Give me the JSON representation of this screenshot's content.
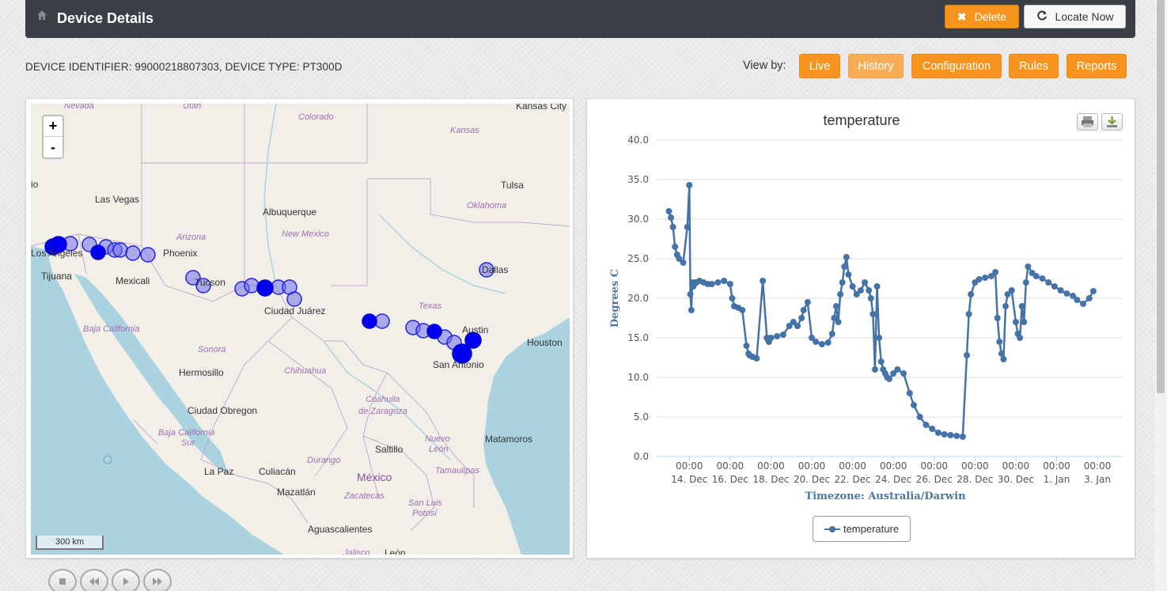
{
  "header": {
    "title": "Device Details",
    "delete_label": "Delete",
    "locate_label": "Locate Now"
  },
  "device_info": "DEVICE IDENTIFIER: 99000218807303, DEVICE TYPE: PT300D",
  "view_by": {
    "label": "View by:",
    "buttons": [
      "Live",
      "History",
      "Configuration",
      "Rules",
      "Reports"
    ],
    "active": "History"
  },
  "map": {
    "zoom_in": "+",
    "zoom_out": "-",
    "scale": "300 km",
    "labels": {
      "nevada": "Nevada",
      "utah": "Utah",
      "colorado": "Colorado",
      "kansas_city": "Kansas City",
      "kansas": "Kansas",
      "tulsa": "Tulsa",
      "oklahoma": "Oklahoma",
      "las_vegas": "Las Vegas",
      "albuquerque": "Albuquerque",
      "arizona": "Arizona",
      "new_mexico": "New Mexico",
      "phoenix": "Phoenix",
      "los_angeles": "Los Angeles",
      "tijuana": "Tijuana",
      "mexicali": "Mexicali",
      "tucson": "Tucson",
      "dallas": "Dallas",
      "ciudad_juarez": "Ciudad Juárez",
      "texas": "Texas",
      "baja_california": "Baja California",
      "austin": "Austin",
      "houston": "Houston",
      "sonora": "Sonora",
      "san_antonio": "San Antonio",
      "hermosillo": "Hermosillo",
      "chihuahua": "Chihuahua",
      "coahuila": "Coahuila",
      "de_zaragoza": "de Zaragoza",
      "ciudad_obregon": "Ciudad Obregon",
      "baja_california_sur": "Baja California",
      "sur": "Sur",
      "nuevo": "Nuevo",
      "leon_state": "León",
      "saltillo": "Saltillo",
      "matamoros": "Matamoros",
      "durango": "Durango",
      "la_paz": "La Paz",
      "culiacan": "Culiacán",
      "mexico": "México",
      "tamaulipas": "Tamaulipas",
      "mazatlan": "Mazatlán",
      "zacatecas": "Zacatecas",
      "san_luis": "San Luis",
      "potosi": "Potosí",
      "aguascalientes": "Aguascalientes",
      "jalisco": "Jalisco",
      "leon": "León",
      "io": "io"
    }
  },
  "chart_data": {
    "type": "line",
    "title": "temperature",
    "xlabel": "Timezone: Australia/Darwin",
    "ylabel": "Degrees C",
    "ylim": [
      0,
      40
    ],
    "yticks": [
      "0.0",
      "5.0",
      "10.0",
      "15.0",
      "20.0",
      "25.0",
      "30.0",
      "35.0",
      "40.0"
    ],
    "xticks": [
      {
        "day": 14,
        "time": "00:00",
        "date": "14. Dec"
      },
      {
        "day": 16,
        "time": "00:00",
        "date": "16. Dec"
      },
      {
        "day": 18,
        "time": "00:00",
        "date": "18. Dec"
      },
      {
        "day": 20,
        "time": "00:00",
        "date": "20. Dec"
      },
      {
        "day": 22,
        "time": "00:00",
        "date": "22. Dec"
      },
      {
        "day": 24,
        "time": "00:00",
        "date": "24. Dec"
      },
      {
        "day": 26,
        "time": "00:00",
        "date": "26. Dec"
      },
      {
        "day": 28,
        "time": "00:00",
        "date": "28. Dec"
      },
      {
        "day": 30,
        "time": "00:00",
        "date": "30. Dec"
      },
      {
        "day": 32,
        "time": "00:00",
        "date": "1. Jan"
      },
      {
        "day": 34,
        "time": "00:00",
        "date": "3. Jan"
      }
    ],
    "legend": "temperature",
    "series": [
      {
        "name": "temperature",
        "color": "#4572a7",
        "x": [
          13.0,
          13.1,
          13.2,
          13.3,
          13.4,
          13.5,
          13.7,
          13.9,
          14.0,
          14.05,
          14.1,
          14.15,
          14.2,
          14.25,
          14.3,
          14.35,
          14.5,
          14.7,
          14.9,
          15.1,
          15.4,
          15.7,
          16.0,
          16.1,
          16.2,
          16.4,
          16.6,
          16.8,
          16.9,
          16.95,
          17.1,
          17.3,
          17.6,
          17.8,
          17.85,
          17.9,
          18.0,
          18.3,
          18.6,
          18.9,
          19.1,
          19.3,
          19.5,
          19.6,
          19.8,
          20.0,
          20.2,
          20.5,
          20.8,
          21.0,
          21.1,
          21.2,
          21.3,
          21.4,
          21.5,
          21.6,
          21.7,
          21.8,
          22.0,
          22.2,
          22.4,
          22.6,
          22.8,
          22.9,
          23.0,
          23.1,
          23.2,
          23.3,
          23.4,
          23.5,
          23.6,
          23.7,
          23.8,
          24.0,
          24.2,
          24.5,
          24.8,
          25.0,
          25.3,
          25.6,
          25.9,
          26.2,
          26.5,
          26.8,
          27.1,
          27.4,
          27.6,
          27.7,
          27.8,
          28.0,
          28.2,
          28.5,
          28.8,
          29.0,
          29.1,
          29.2,
          29.3,
          29.4,
          29.5,
          29.6,
          29.8,
          30.0,
          30.1,
          30.2,
          30.3,
          30.4,
          30.5,
          30.6,
          30.8,
          31.0,
          31.3,
          31.6,
          31.9,
          32.2,
          32.5,
          32.8,
          33.0,
          33.3,
          33.6,
          33.8
        ],
        "y": [
          31.0,
          30.2,
          29.0,
          26.5,
          25.5,
          25.0,
          24.5,
          29.0,
          34.3,
          20.5,
          18.5,
          22.0,
          21.5,
          21.8,
          22.0,
          22.0,
          22.2,
          22.0,
          21.8,
          21.8,
          22.0,
          22.2,
          21.8,
          20.0,
          19.0,
          18.8,
          18.5,
          14.0,
          13.0,
          12.8,
          12.6,
          12.4,
          22.2,
          15.0,
          14.8,
          14.5,
          15.0,
          15.2,
          15.4,
          16.5,
          17.0,
          16.5,
          17.5,
          18.5,
          19.5,
          15.0,
          14.5,
          14.2,
          14.4,
          15.5,
          17.5,
          19.0,
          17.0,
          20.5,
          22.0,
          24.0,
          25.2,
          23.0,
          21.5,
          20.5,
          21.0,
          22.0,
          21.0,
          20.0,
          18.0,
          11.0,
          21.5,
          15.0,
          12.0,
          11.0,
          10.5,
          10.0,
          9.8,
          10.5,
          11.0,
          10.5,
          8.0,
          6.5,
          5.0,
          4.0,
          3.5,
          3.0,
          2.8,
          2.7,
          2.6,
          2.5,
          12.8,
          18.0,
          20.5,
          22.0,
          22.4,
          22.6,
          22.8,
          23.3,
          17.5,
          14.5,
          13.0,
          12.3,
          19.0,
          20.5,
          21.0,
          17.0,
          15.5,
          15.0,
          19.0,
          17.0,
          22.0,
          24.0,
          23.2,
          22.8,
          22.5,
          22.0,
          21.5,
          21.0,
          20.6,
          20.3,
          19.8,
          19.3,
          20.0,
          20.9
        ]
      }
    ]
  }
}
